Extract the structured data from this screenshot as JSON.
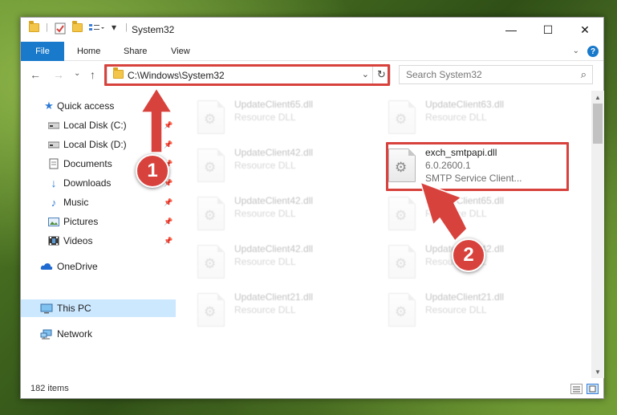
{
  "window": {
    "title": "System32",
    "controls": {
      "minimize": "—",
      "maximize": "☐",
      "close": "✕"
    }
  },
  "ribbon": {
    "tabs": [
      "File",
      "Home",
      "Share",
      "View"
    ],
    "help": "?"
  },
  "nav": {
    "address": "C:\\Windows\\System32",
    "search_placeholder": "Search System32"
  },
  "sidebar": {
    "items": [
      {
        "label": "Quick access",
        "icon": "star-icon"
      },
      {
        "label": "Local Disk (C:)",
        "icon": "drive-icon",
        "pinned": true
      },
      {
        "label": "Local Disk (D:)",
        "icon": "drive-icon",
        "pinned": true
      },
      {
        "label": "Documents",
        "icon": "documents-icon",
        "pinned": true
      },
      {
        "label": "Downloads",
        "icon": "download-icon",
        "pinned": true
      },
      {
        "label": "Music",
        "icon": "music-icon",
        "pinned": true
      },
      {
        "label": "Pictures",
        "icon": "pictures-icon",
        "pinned": true
      },
      {
        "label": "Videos",
        "icon": "videos-icon",
        "pinned": true
      },
      {
        "label": "OneDrive",
        "icon": "cloud-icon"
      },
      {
        "label": "This PC",
        "icon": "computer-icon",
        "selected": true
      },
      {
        "label": "Network",
        "icon": "network-icon"
      }
    ]
  },
  "files": [
    {
      "name": "UpdateClient65.dll",
      "type": "Resource DLL",
      "blurred": true
    },
    {
      "name": "UpdateClient63.dll",
      "type": "Resource DLL",
      "blurred": true
    },
    {
      "name": "UpdateClient42.dll",
      "type": "Resource DLL",
      "blurred": true
    },
    {
      "name": "exch_smtpapi.dll",
      "version": "6.0.2600.1",
      "description": "SMTP Service Client...",
      "blurred": false
    },
    {
      "name": "UpdateClient42.dll",
      "type": "Resource DLL",
      "blurred": true
    },
    {
      "name": "UpdateClient65.dll",
      "type": "Resource DLL",
      "blurred": true
    },
    {
      "name": "UpdateClient42.dll",
      "type": "Resource DLL",
      "blurred": true
    },
    {
      "name": "UpdateClient42.dll",
      "type": "Resource DLL",
      "blurred": true
    },
    {
      "name": "UpdateClient21.dll",
      "type": "Resource DLL",
      "blurred": true
    },
    {
      "name": "UpdateClient21.dll",
      "type": "Resource DLL",
      "blurred": true
    }
  ],
  "status": {
    "item_count": "182 items"
  },
  "annotations": {
    "step1": "1",
    "step2": "2",
    "accent": "#d8423d"
  }
}
